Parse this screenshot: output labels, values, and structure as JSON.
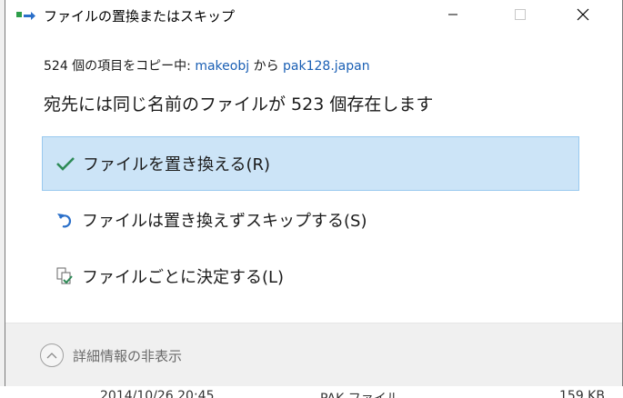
{
  "window": {
    "title": "ファイルの置換またはスキップ"
  },
  "copy_info": {
    "prefix": "524 個の項目をコピー中: ",
    "source": "makeobj",
    "middle": " から ",
    "destination": "pak128.japan"
  },
  "heading": "宛先には同じ名前のファイルが 523 個存在します",
  "options": [
    {
      "label": "ファイルを置き換える(R)",
      "icon": "check-icon",
      "selected": true
    },
    {
      "label": "ファイルは置き換えずスキップする(S)",
      "icon": "skip-arrow-icon",
      "selected": false
    },
    {
      "label": "ファイルごとに決定する(L)",
      "icon": "compare-files-icon",
      "selected": false
    }
  ],
  "footer": {
    "details_label": "詳細情報の非表示"
  },
  "background_row": {
    "date": "2014/10/26 20:45",
    "type": "PAK ファイル",
    "size": "159 KB"
  },
  "colors": {
    "selected_bg": "#cce4f7",
    "selected_border": "#99c9ef",
    "link": "#1a5fb4",
    "check": "#2e8b57",
    "skip_arrow": "#2a6fc9"
  }
}
